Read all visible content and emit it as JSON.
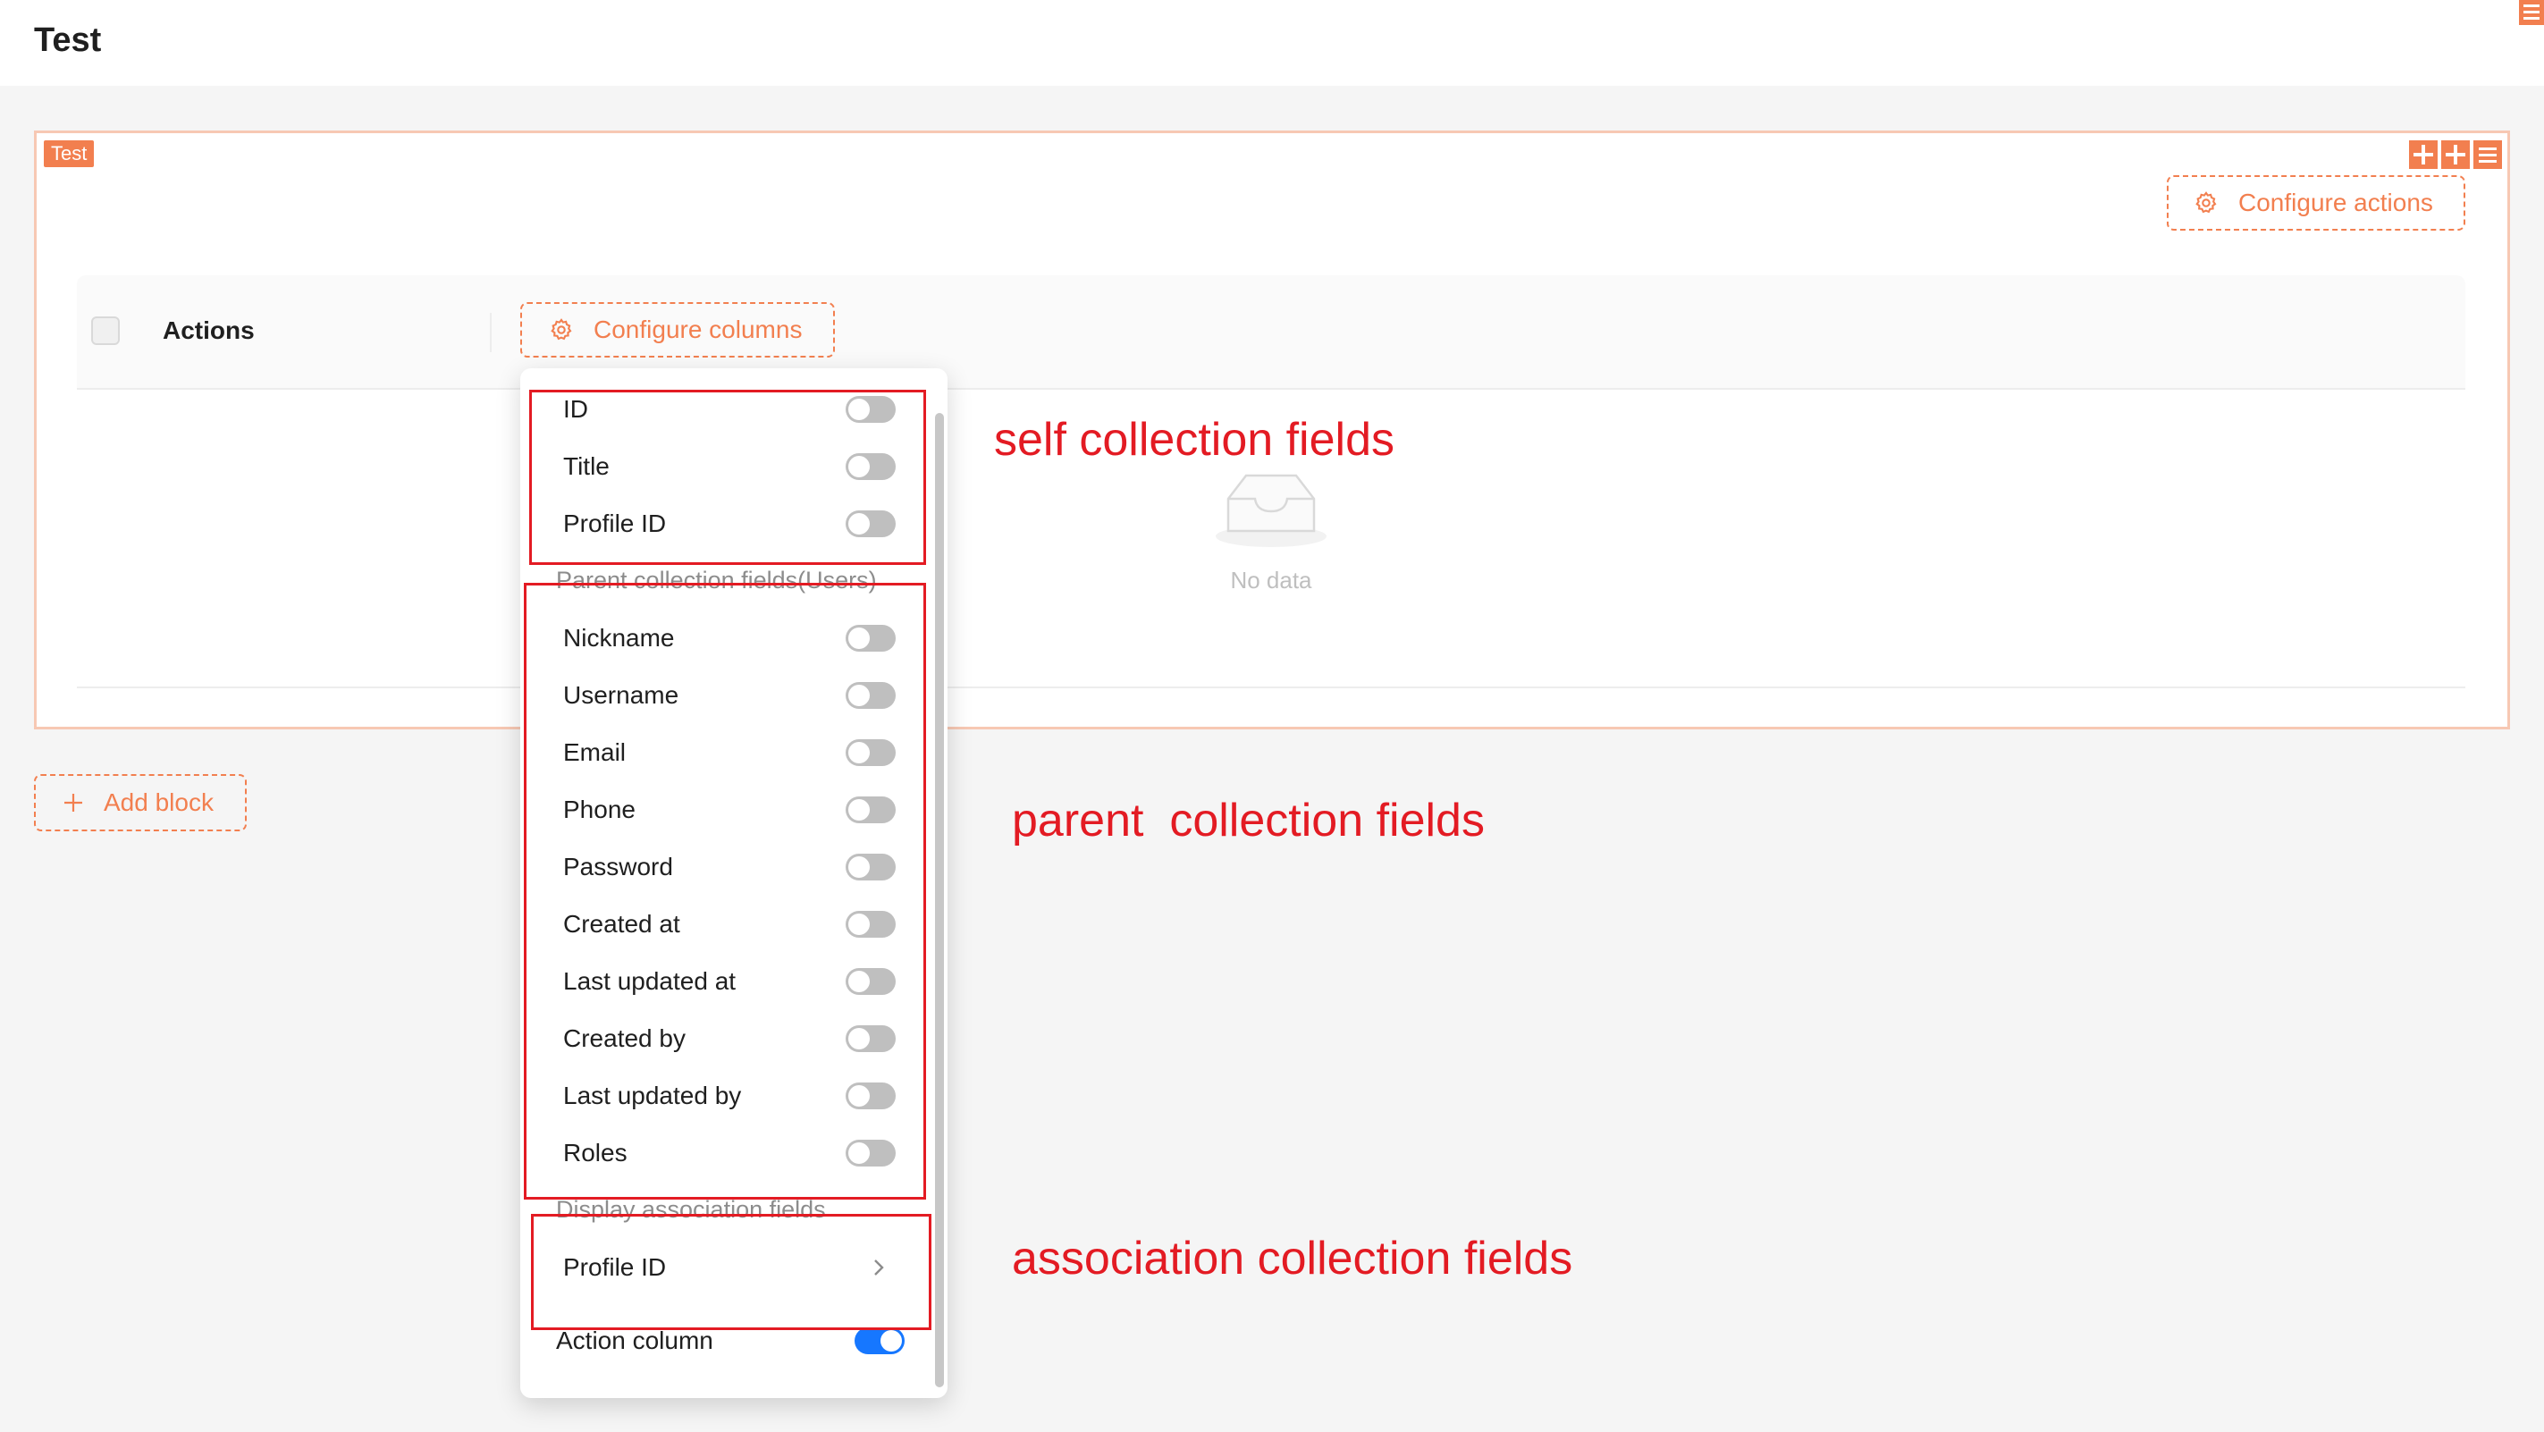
{
  "page": {
    "title": "Test"
  },
  "block": {
    "tag": "Test",
    "configure_actions_label": "Configure actions",
    "configure_columns_label": "Configure columns",
    "table": {
      "columns": [
        "Actions"
      ],
      "empty_text": "No data"
    }
  },
  "add_block_label": "Add block",
  "dropdown": {
    "self_fields": [
      {
        "label": "ID",
        "enabled": false
      },
      {
        "label": "Title",
        "enabled": false
      },
      {
        "label": "Profile ID",
        "enabled": false
      }
    ],
    "parent_group_title": "Parent collection fields(Users)",
    "parent_fields": [
      {
        "label": "Nickname",
        "enabled": false
      },
      {
        "label": "Username",
        "enabled": false
      },
      {
        "label": "Email",
        "enabled": false
      },
      {
        "label": "Phone",
        "enabled": false
      },
      {
        "label": "Password",
        "enabled": false
      },
      {
        "label": "Created at",
        "enabled": false
      },
      {
        "label": "Last updated at",
        "enabled": false
      },
      {
        "label": "Created by",
        "enabled": false
      },
      {
        "label": "Last updated by",
        "enabled": false
      },
      {
        "label": "Roles",
        "enabled": false
      }
    ],
    "association_group_title": "Display association fields",
    "association_fields": [
      {
        "label": "Profile ID"
      }
    ],
    "action_column": {
      "label": "Action column",
      "enabled": true
    }
  },
  "annotations": {
    "self": "self collection fields",
    "parent": "parent  collection fields",
    "association": "association collection fields"
  },
  "colors": {
    "accent": "#f27f4f",
    "annotation": "#e31b23",
    "switch_on": "#1677ff"
  }
}
